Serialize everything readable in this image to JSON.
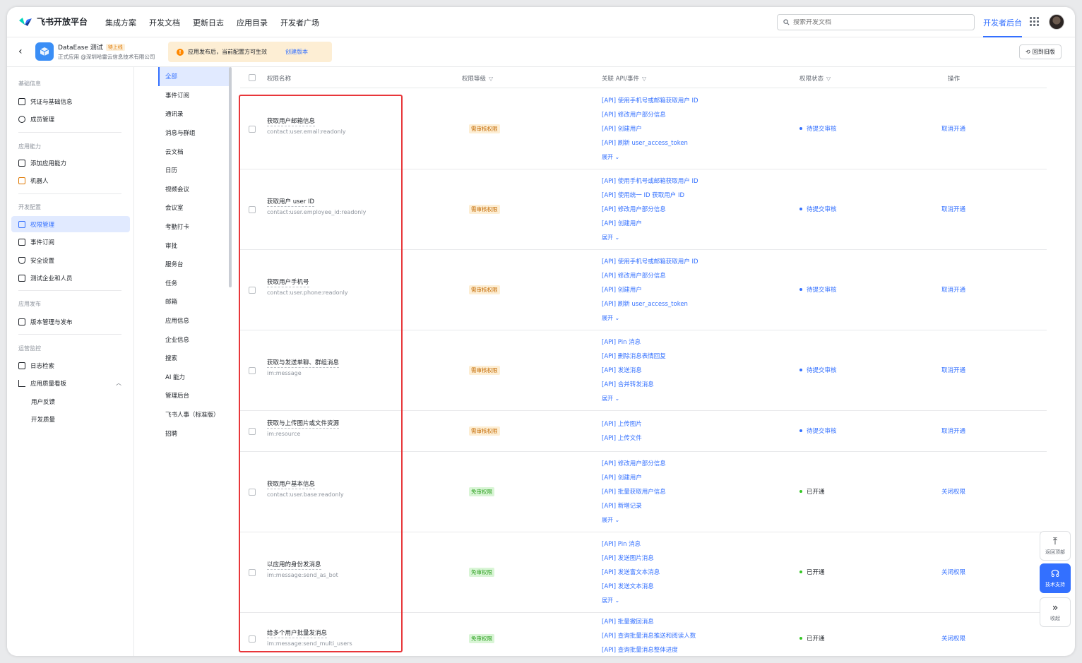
{
  "header": {
    "brand": "飞书开放平台",
    "nav": [
      "集成方案",
      "开发文档",
      "更新日志",
      "应用目录",
      "开发者广场"
    ],
    "search_placeholder": "搜索开发文档",
    "dev_console": "开发者后台"
  },
  "app": {
    "name": "DataEase 测试",
    "tag": "待上线",
    "subtitle": "正式应用 @深圳哈雷云信息技术有限公司",
    "notice": "应用发布后，当前配置方可生效",
    "notice_link": "创建版本",
    "revert": "回到旧版"
  },
  "sidebar": {
    "groups": [
      {
        "title": "基础信息",
        "items": [
          {
            "label": "凭证与基础信息",
            "icon": "credential-icon"
          },
          {
            "label": "成员管理",
            "icon": "user-icon"
          }
        ]
      },
      {
        "title": "应用能力",
        "items": [
          {
            "label": "添加应用能力",
            "icon": "grid-plus-icon"
          },
          {
            "label": "机器人",
            "icon": "robot-icon"
          }
        ]
      },
      {
        "title": "开发配置",
        "items": [
          {
            "label": "权限管理",
            "icon": "permission-icon"
          },
          {
            "label": "事件订阅",
            "icon": "event-icon"
          },
          {
            "label": "安全设置",
            "icon": "shield-icon"
          },
          {
            "label": "测试企业和人员",
            "icon": "test-icon"
          }
        ]
      },
      {
        "title": "应用发布",
        "items": [
          {
            "label": "版本管理与发布",
            "icon": "upload-icon"
          }
        ]
      },
      {
        "title": "运营监控",
        "items": [
          {
            "label": "日志检索",
            "icon": "log-icon"
          },
          {
            "label": "应用质量看板",
            "icon": "chart-icon"
          },
          {
            "label": "用户反馈",
            "icon": ""
          },
          {
            "label": "开发质量",
            "icon": ""
          }
        ]
      }
    ]
  },
  "categories": [
    "全部",
    "事件订阅",
    "通讯录",
    "消息与群组",
    "云文档",
    "日历",
    "视频会议",
    "会议室",
    "考勤打卡",
    "审批",
    "服务台",
    "任务",
    "邮箱",
    "应用信息",
    "企业信息",
    "搜索",
    "AI 能力",
    "管理后台",
    "飞书人事（标准版）",
    "招聘"
  ],
  "table": {
    "headers": {
      "name": "权限名称",
      "level": "权限等级",
      "api": "关联 API/事件",
      "status": "权限状态",
      "action": "操作"
    },
    "expand_label": "展开",
    "rows": [
      {
        "name": "获取用户邮箱信息",
        "code": "contact:user.email:readonly",
        "level": "需审核权限",
        "apis": [
          "[API] 使用手机号或邮箱获取用户 ID",
          "[API] 修改用户部分信息",
          "[API] 创建用户",
          "[API] 刷新 user_access_token"
        ],
        "status": "待提交审核",
        "action": "取消开通"
      },
      {
        "name": "获取用户 user ID",
        "code": "contact:user.employee_id:readonly",
        "level": "需审核权限",
        "apis": [
          "[API] 使用手机号或邮箱获取用户 ID",
          "[API] 使用统一 ID 获取用户 ID",
          "[API] 修改用户部分信息",
          "[API] 创建用户"
        ],
        "status": "待提交审核",
        "action": "取消开通"
      },
      {
        "name": "获取用户手机号",
        "code": "contact:user.phone:readonly",
        "level": "需审核权限",
        "apis": [
          "[API] 使用手机号或邮箱获取用户 ID",
          "[API] 修改用户部分信息",
          "[API] 创建用户",
          "[API] 刷新 user_access_token"
        ],
        "status": "待提交审核",
        "action": "取消开通"
      },
      {
        "name": "获取与发送单聊、群组消息",
        "code": "im:message",
        "level": "需审核权限",
        "apis": [
          "[API] Pin 消息",
          "[API] 删除消息表情回复",
          "[API] 发送消息",
          "[API] 合并转发消息"
        ],
        "status": "待提交审核",
        "action": "取消开通"
      },
      {
        "name": "获取与上传图片或文件资源",
        "code": "im:resource",
        "level": "需审核权限",
        "apis": [
          "[API] 上传图片",
          "[API] 上传文件"
        ],
        "status": "待提交审核",
        "action": "取消开通"
      },
      {
        "name": "获取用户基本信息",
        "code": "contact:user.base:readonly",
        "level": "免审权限",
        "apis": [
          "[API] 修改用户部分信息",
          "[API] 创建用户",
          "[API] 批量获取用户信息",
          "[API] 新增记录"
        ],
        "status": "已开通",
        "action": "关闭权限"
      },
      {
        "name": "以应用的身份发消息",
        "code": "im:message:send_as_bot",
        "level": "免审权限",
        "apis": [
          "[API] Pin 消息",
          "[API] 发送图片消息",
          "[API] 发送富文本消息",
          "[API] 发送文本消息"
        ],
        "status": "已开通",
        "action": "关闭权限"
      },
      {
        "name": "给多个用户批量发消息",
        "code": "im:message:send_multi_users",
        "level": "免审权限",
        "apis": [
          "[API] 批量撤回消息",
          "[API] 查询批量消息推送和阅读人数",
          "[API] 查询批量消息整体进度"
        ],
        "status": "已开通",
        "action": "关闭权限"
      }
    ]
  },
  "floating": {
    "top": "返回顶部",
    "support": "技术支持",
    "collapse": "收起"
  }
}
